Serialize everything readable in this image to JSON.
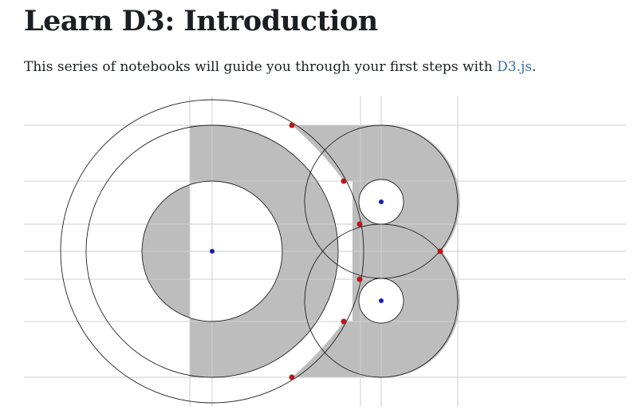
{
  "page": {
    "title": "Learn D3: Introduction",
    "intro": {
      "text_before": "This series of notebooks will guide you through your first steps with ",
      "link_label": "D3.js",
      "text_after": "."
    }
  },
  "colors": {
    "text": "#1b1e23",
    "link": "#3b6fa0",
    "fill": "#bdbdbd",
    "stroke": "#222222",
    "grid": "#cfcfcf",
    "tangent_point": "#c0141c",
    "center_point": "#1320b0"
  }
}
